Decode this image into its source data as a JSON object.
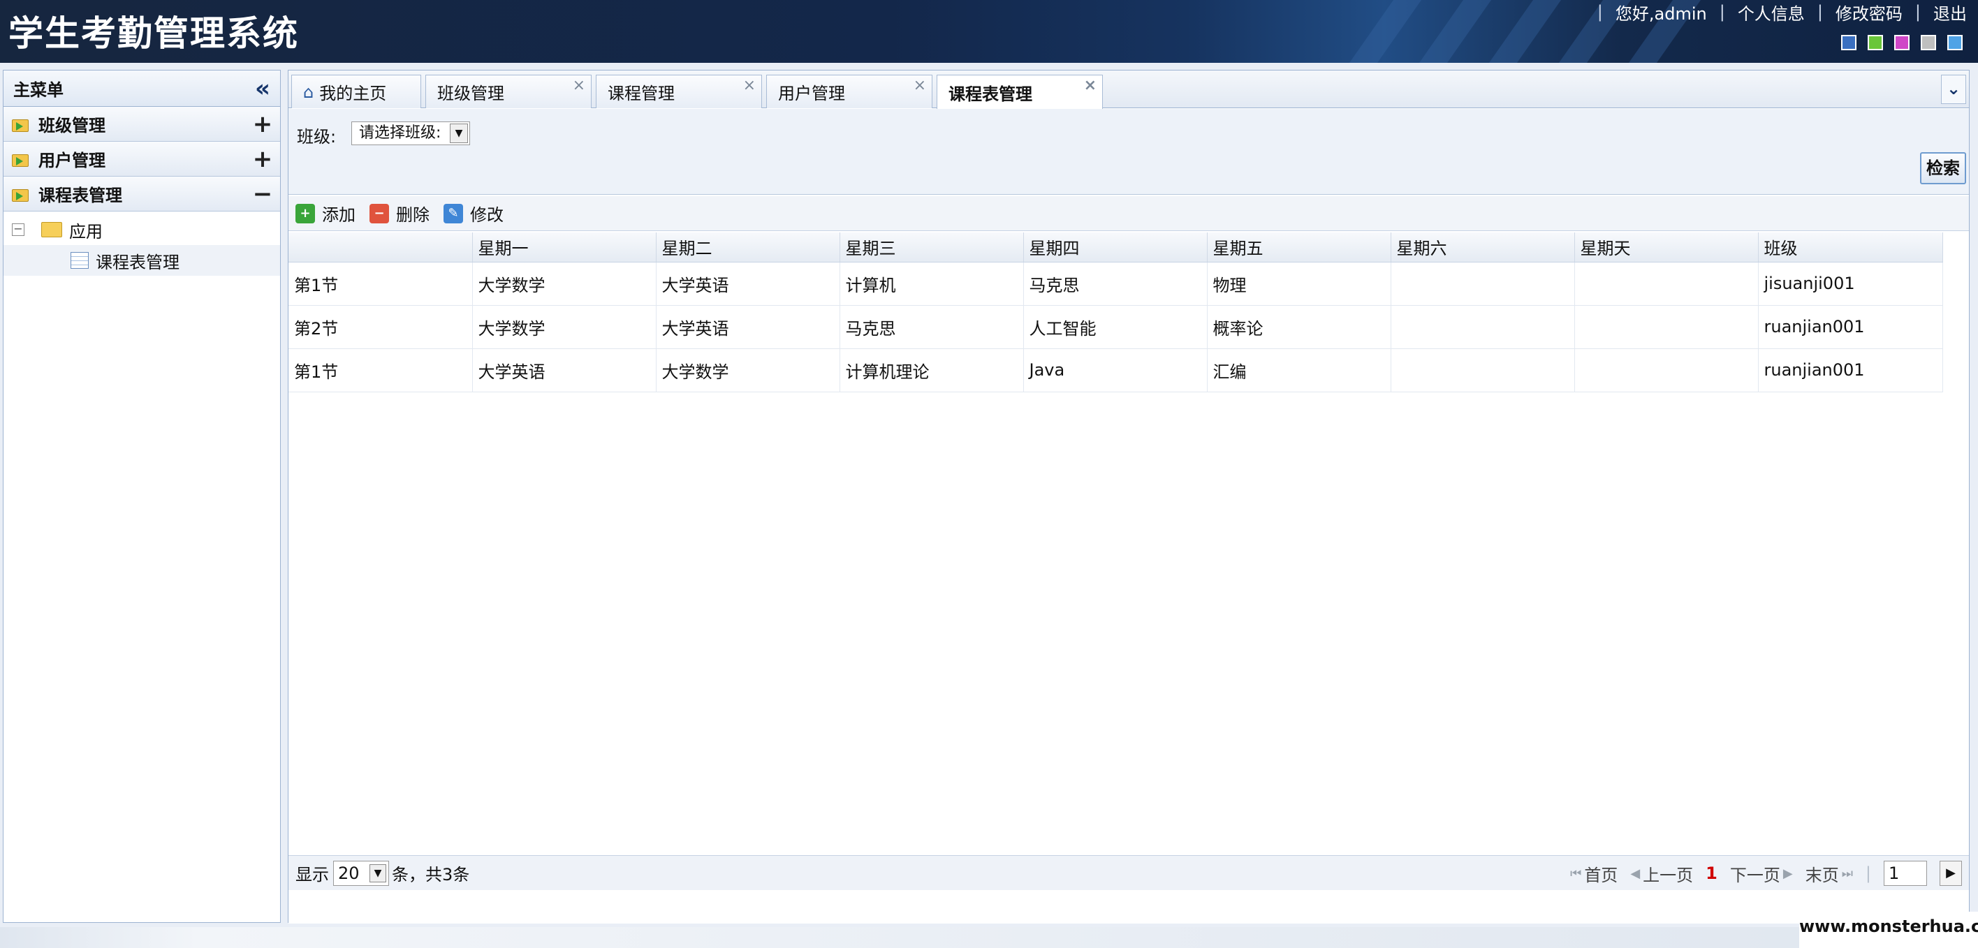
{
  "header": {
    "app_title": "学生考勤管理系统",
    "greeting": "您好,admin",
    "links": [
      "个人信息",
      "修改密码",
      "退出"
    ],
    "theme_colors": [
      "#3a6fc0",
      "#6ac63a",
      "#cf47c7",
      "#bfbfbf",
      "#4fa3e6"
    ]
  },
  "sidebar": {
    "title": "主菜单",
    "sections": [
      {
        "label": "班级管理",
        "toggle": "+"
      },
      {
        "label": "用户管理",
        "toggle": "+"
      },
      {
        "label": "课程表管理",
        "toggle": "−"
      }
    ],
    "tree": {
      "folder": "应用",
      "child": "课程表管理"
    }
  },
  "tabs": [
    {
      "label": "我的主页",
      "closable": false
    },
    {
      "label": "班级管理",
      "closable": true
    },
    {
      "label": "课程管理",
      "closable": true
    },
    {
      "label": "用户管理",
      "closable": true
    },
    {
      "label": "课程表管理",
      "closable": true,
      "active": true
    }
  ],
  "search": {
    "class_label": "班级:",
    "class_select_value": "请选择班级:",
    "search_button": "检索"
  },
  "toolbar": {
    "add": "添加",
    "delete": "删除",
    "edit": "修改"
  },
  "table": {
    "columns": [
      "",
      "星期一",
      "星期二",
      "星期三",
      "星期四",
      "星期五",
      "星期六",
      "星期天",
      "班级"
    ],
    "rows": [
      [
        "第1节",
        "大学数学",
        "大学英语",
        "计算机",
        "马克思",
        "物理",
        "",
        "",
        "jisuanji001"
      ],
      [
        "第2节",
        "大学数学",
        "大学英语",
        "马克思",
        "人工智能",
        "概率论",
        "",
        "",
        "ruanjian001"
      ],
      [
        "第1节",
        "大学英语",
        "大学数学",
        "计算机理论",
        "Java",
        "汇编",
        "",
        "",
        "ruanjian001"
      ]
    ]
  },
  "pager": {
    "show_label": "显示",
    "page_size": "20",
    "summary": "条，共3条",
    "first": "首页",
    "prev": "上一页",
    "current": "1",
    "next": "下一页",
    "last": "末页",
    "page_input": "1"
  },
  "watermark": "www.monsterhua.com"
}
